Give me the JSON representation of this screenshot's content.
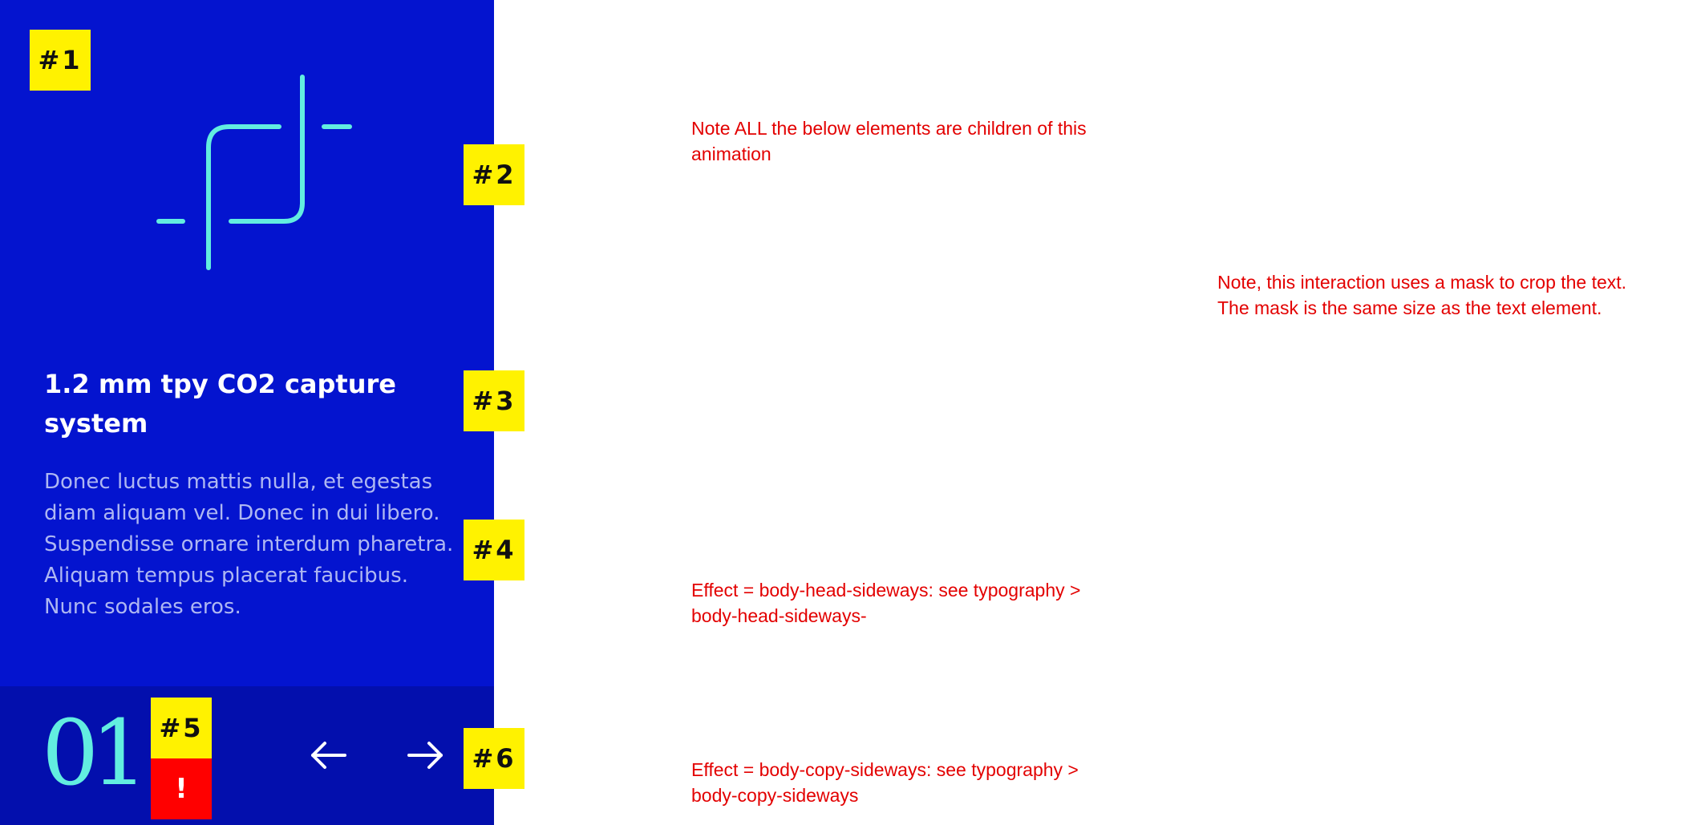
{
  "card": {
    "title": "1.2 mm tpy CO2 capture system",
    "body": "Donec luctus mattis nulla, et egestas diam aliquam vel. Donec in dui libero. Suspendisse ornare interdum pharetra. Aliquam tempus placerat faucibus. Nunc sodales eros.",
    "index": "01",
    "icon": "crop-frame-icon",
    "prev_icon": "arrow-left-icon",
    "next_icon": "arrow-right-icon",
    "colors": {
      "background": "#0414CF",
      "footer": "#030FAD",
      "accent": "#62EDE0",
      "body_text": "#AEB7F2"
    }
  },
  "markers": {
    "m1": "#1",
    "m2": "#2",
    "m3": "#3",
    "m4": "#4",
    "m5": "#5",
    "m6": "#6",
    "warning": "!"
  },
  "notes": {
    "animation": "Note ALL the below elements are children of this\nanimation",
    "mask": "Note, this interaction uses a mask to crop the text.\nThe mask is the same size as the text element.",
    "head_effect": "Effect = body-head-sideways: see typography >\nbody-head-sideways-",
    "copy_effect": "Effect = body-copy-sideways:  see typography >\nbody-copy-sideways"
  },
  "colors": {
    "marker": "#FFF200",
    "warning": "#FF0000",
    "note_text": "#E30000"
  }
}
